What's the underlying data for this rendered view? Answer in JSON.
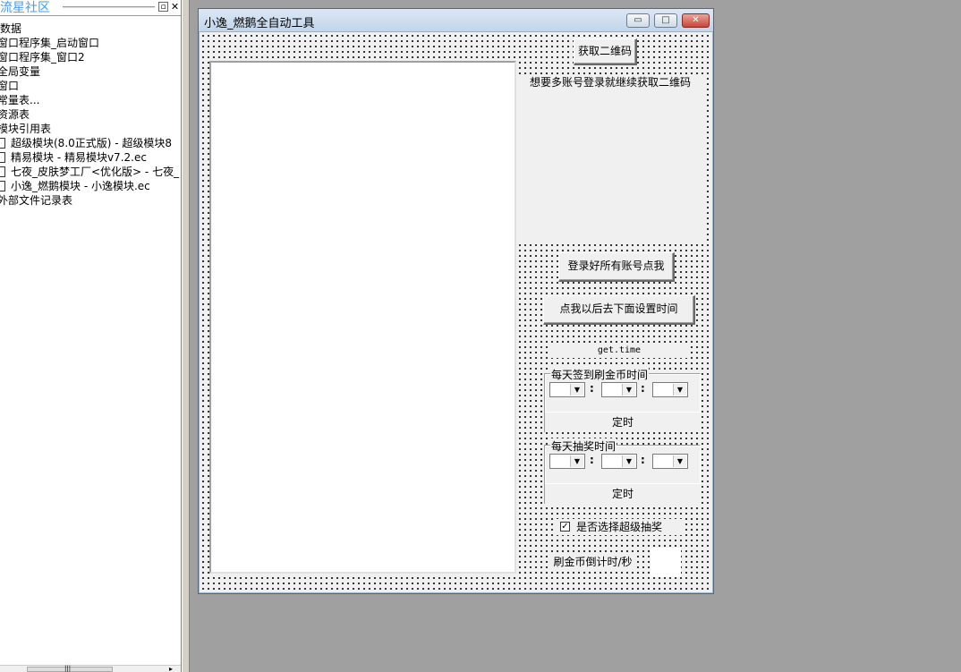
{
  "panel": {
    "brand": "流星社区",
    "pin_icon": "pin-icon",
    "close_icon": "close-icon",
    "items": [
      "数据",
      "窗口程序集_启动窗口",
      "窗口程序集_窗口2",
      "全局变量",
      "窗口",
      "常量表...",
      "资源表",
      "模块引用表",
      "超级模块(8.0正式版) - 超级模块8",
      "精易模块 - 精易模块v7.2.ec",
      "七夜_皮肤梦工厂<优化版> - 七夜_",
      "小逸_燃鹅模块 - 小逸模块.ec",
      "外部文件记录表"
    ],
    "scroll_grip": "|||"
  },
  "window": {
    "title": "小逸_燃鹅全自动工具",
    "min_glyph": "▭",
    "max_glyph": "□",
    "close_glyph": "✕"
  },
  "form": {
    "get_qr_button": "获取二维码",
    "hint": "想要多账号登录就继续获取二维码",
    "login_all_button": "登录好所有账号点我",
    "set_time_button": "点我以后去下面设置时间",
    "time_label": "get.time",
    "group1": {
      "legend": "每天签到刷金币时间",
      "timer_button": "定时"
    },
    "group2": {
      "legend": "每天抽奖时间",
      "timer_button": "定时"
    },
    "colon": ":",
    "dropdown_glyph": "▼",
    "super_lottery_checkbox": "是否选择超级抽奖",
    "checked_glyph": "✓",
    "countdown_label": "刷金币倒计时/秒"
  }
}
